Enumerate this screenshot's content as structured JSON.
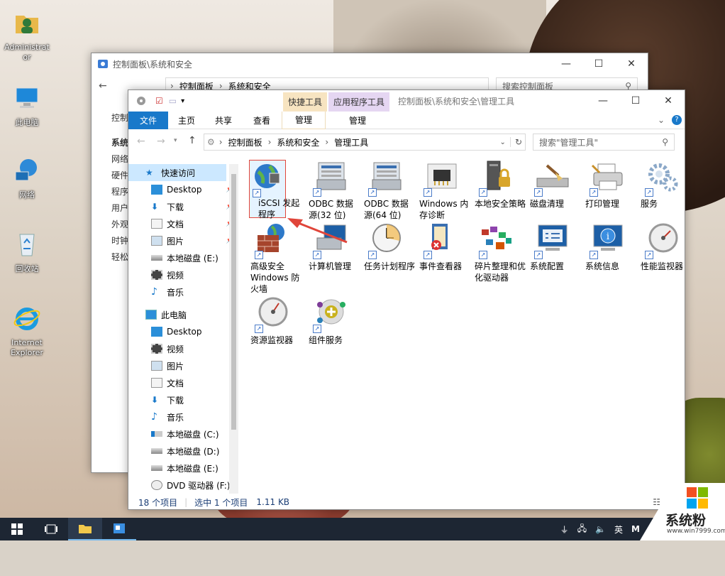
{
  "desktop": {
    "icons": [
      {
        "label": "Administrator",
        "icon": "user-folder-icon"
      },
      {
        "label": "此电脑",
        "icon": "computer-icon"
      },
      {
        "label": "网络",
        "icon": "network-icon"
      },
      {
        "label": "回收站",
        "icon": "recycle-bin-icon"
      },
      {
        "label": "Internet Explorer",
        "icon": "ie-icon"
      }
    ]
  },
  "back_window": {
    "title": "控制面板\\系统和安全",
    "address": [
      "控制面板",
      "系统和安全"
    ],
    "search_placeholder": "搜索控制面板",
    "side": [
      "控制",
      "系统",
      "网络",
      "硬件",
      "程序",
      "用户",
      "外观",
      "时钟",
      "轻松"
    ]
  },
  "front_window": {
    "title": "控制面板\\系统和安全\\管理工具",
    "context_tabs": {
      "shortcut_tools": "快捷工具",
      "app_tools": "应用程序工具"
    },
    "ribbon_tabs": [
      "文件",
      "主页",
      "共享",
      "查看",
      "管理",
      "管理"
    ],
    "address": [
      "控制面板",
      "系统和安全",
      "管理工具"
    ],
    "search_placeholder": "搜索\"管理工具\"",
    "nav": {
      "quick_access": "快速访问",
      "quick_items": [
        "Desktop",
        "下载",
        "文档",
        "图片",
        "本地磁盘 (E:)",
        "视频",
        "音乐"
      ],
      "this_pc": "此电脑",
      "pc_items": [
        "Desktop",
        "视频",
        "图片",
        "文档",
        "下载",
        "音乐",
        "本地磁盘 (C:)",
        "本地磁盘 (D:)",
        "本地磁盘 (E:)",
        "DVD 驱动器 (F:)"
      ]
    },
    "items": [
      {
        "label": "iSCSI 发起程序",
        "icon": "iscsi-icon"
      },
      {
        "label": "ODBC 数据源(32 位)",
        "icon": "odbc-icon"
      },
      {
        "label": "ODBC 数据源(64 位)",
        "icon": "odbc-icon"
      },
      {
        "label": "Windows 内存诊断",
        "icon": "memory-icon"
      },
      {
        "label": "本地安全策略",
        "icon": "security-policy-icon"
      },
      {
        "label": "磁盘清理",
        "icon": "disk-cleanup-icon"
      },
      {
        "label": "打印管理",
        "icon": "print-icon"
      },
      {
        "label": "服务",
        "icon": "services-icon"
      },
      {
        "label": "高级安全 Windows 防火墙",
        "icon": "firewall-icon"
      },
      {
        "label": "计算机管理",
        "icon": "computer-management-icon"
      },
      {
        "label": "任务计划程序",
        "icon": "task-scheduler-icon"
      },
      {
        "label": "事件查看器",
        "icon": "event-viewer-icon"
      },
      {
        "label": "碎片整理和优化驱动器",
        "icon": "defrag-icon"
      },
      {
        "label": "系统配置",
        "icon": "sysconfig-icon"
      },
      {
        "label": "系统信息",
        "icon": "sysinfo-icon"
      },
      {
        "label": "性能监视器",
        "icon": "perfmon-icon"
      },
      {
        "label": "资源监视器",
        "icon": "resmon-icon"
      },
      {
        "label": "组件服务",
        "icon": "component-icon"
      }
    ],
    "status": {
      "count": "18 个项目",
      "selected": "选中 1 个项目",
      "size": "1.11 KB"
    }
  },
  "taskbar": {
    "ime": "英",
    "tray_m": "M"
  },
  "watermark": {
    "brand": "系统粉",
    "url": "www.win7999.com"
  },
  "colors": {
    "ribbon_file": "#1979ca",
    "shortcut_tab": "#f7e4c1",
    "app_tab": "#e5d6f2",
    "taskbar": "#1d2633"
  }
}
